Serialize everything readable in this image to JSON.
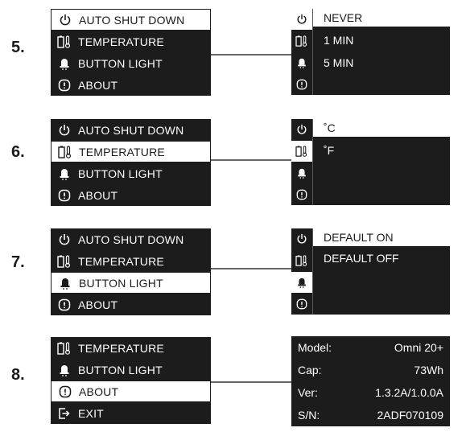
{
  "steps": [
    {
      "number": "5.",
      "menu": [
        "AUTO SHUT DOWN",
        "TEMPERATURE",
        "BUTTON LIGHT",
        "ABOUT"
      ],
      "options": [
        "NEVER",
        "1 MIN",
        "5 MIN",
        ""
      ]
    },
    {
      "number": "6.",
      "menu": [
        "AUTO SHUT DOWN",
        "TEMPERATURE",
        "BUTTON LIGHT",
        "ABOUT"
      ],
      "options": [
        "˚C",
        "˚F"
      ]
    },
    {
      "number": "7.",
      "menu": [
        "AUTO SHUT DOWN",
        "TEMPERATURE",
        "BUTTON LIGHT",
        "ABOUT"
      ],
      "options": [
        "DEFAULT ON",
        "DEFAULT OFF"
      ]
    },
    {
      "number": "8.",
      "menu": [
        "TEMPERATURE",
        "BUTTON LIGHT",
        "ABOUT",
        "EXIT"
      ],
      "info": [
        {
          "label": "Model:",
          "value": "Omni 20+"
        },
        {
          "label": "Cap:",
          "value": "73Wh"
        },
        {
          "label": "Ver:",
          "value": "1.3.2A/1.0.0A"
        },
        {
          "label": "S/N:",
          "value": "2ADF070109"
        }
      ]
    }
  ],
  "icons": {
    "power": "power-icon",
    "thermometer": "battery-thermometer-icon",
    "bell": "bell-icon",
    "info": "info-icon",
    "exit": "exit-icon"
  },
  "colors": {
    "panel": "#1c1c1c",
    "selected": "#ffffff",
    "connector": "#666666"
  }
}
